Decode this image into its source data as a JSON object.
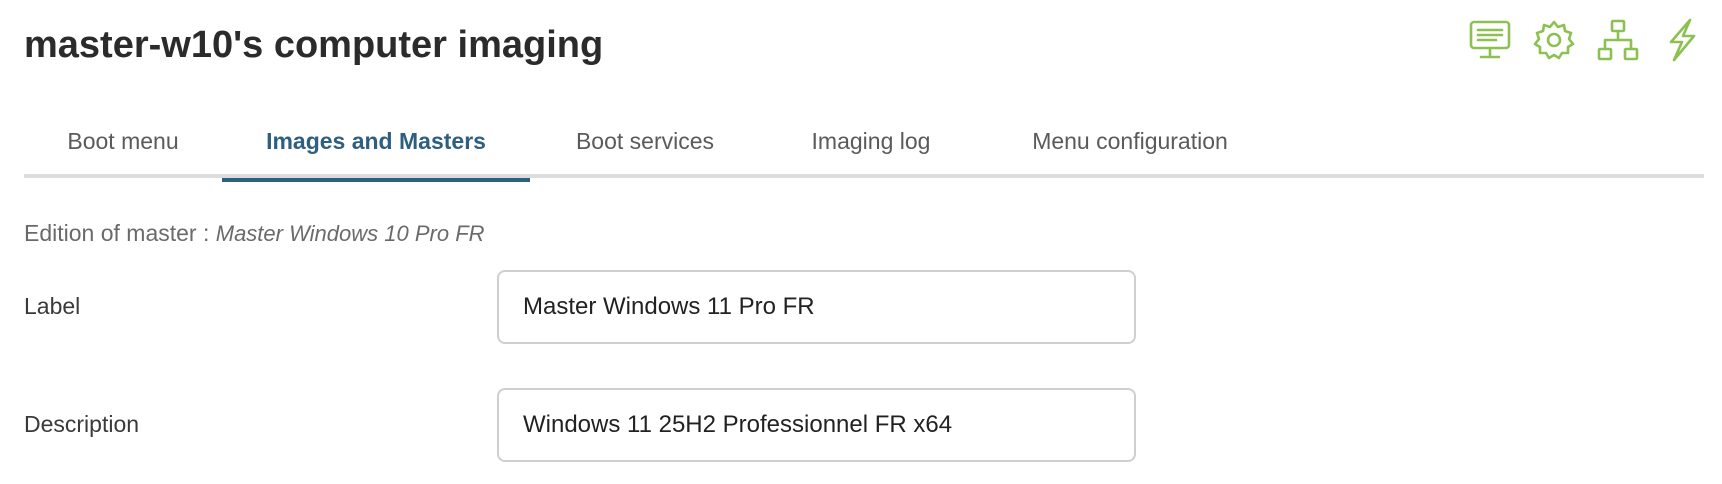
{
  "header": {
    "title": "master-w10's computer imaging"
  },
  "toolbar": {
    "accent_color": "#8cc152",
    "buttons": [
      {
        "icon": "monitor-icon"
      },
      {
        "icon": "gear-icon"
      },
      {
        "icon": "network-icon"
      },
      {
        "icon": "lightning-icon"
      }
    ]
  },
  "tabs": [
    {
      "label": "Boot menu",
      "active": false
    },
    {
      "label": "Images and Masters",
      "active": true
    },
    {
      "label": "Boot services",
      "active": false
    },
    {
      "label": "Imaging log",
      "active": false
    },
    {
      "label": "Menu configuration",
      "active": false
    }
  ],
  "edition": {
    "prefix": "Edition of master : ",
    "master_name": "Master Windows 10 Pro FR"
  },
  "form": {
    "label_field": {
      "label": "Label",
      "value": "Master Windows 11 Pro FR"
    },
    "description_field": {
      "label": "Description",
      "value": "Windows 11 25H2 Professionnel FR x64"
    }
  }
}
